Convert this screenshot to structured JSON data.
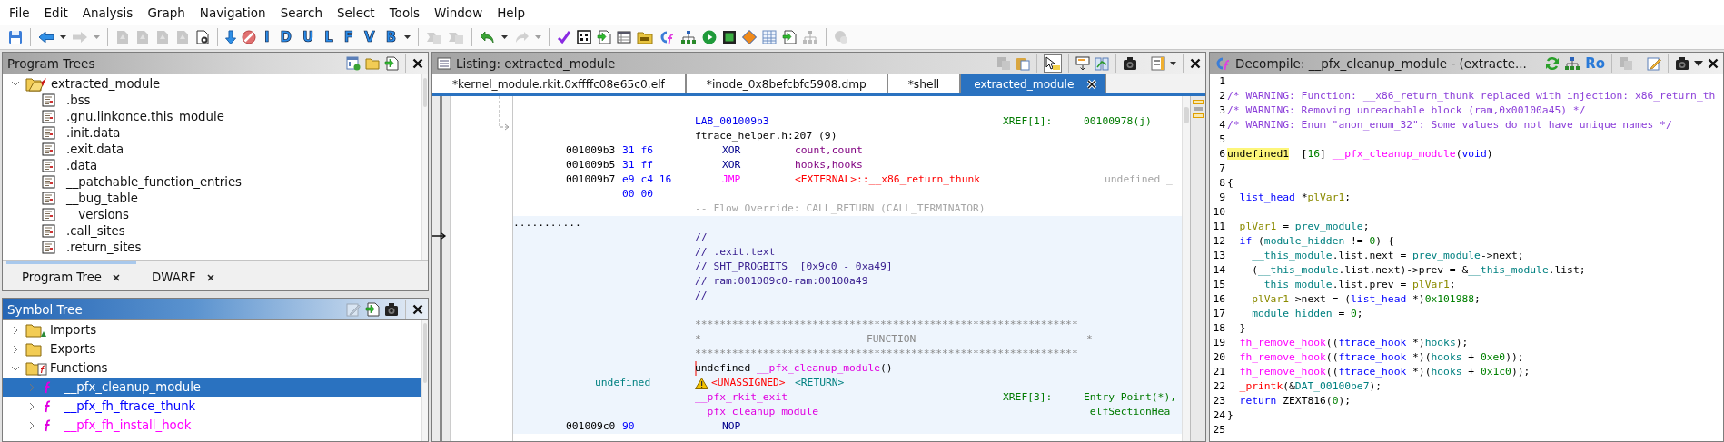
{
  "menu": [
    "File",
    "Edit",
    "Analysis",
    "Graph",
    "Navigation",
    "Search",
    "Select",
    "Tools",
    "Window",
    "Help"
  ],
  "toolbar": [
    {
      "kind": "save",
      "disabled": false
    },
    {
      "kind": "separator"
    },
    {
      "kind": "back",
      "disabled": false
    },
    {
      "kind": "dropdown",
      "disabled": false
    },
    {
      "kind": "forward",
      "disabled": true
    },
    {
      "kind": "dropdown",
      "disabled": true
    },
    {
      "kind": "separator"
    },
    {
      "kind": "doc",
      "disabled": true
    },
    {
      "kind": "doc",
      "disabled": true
    },
    {
      "kind": "doc",
      "disabled": true
    },
    {
      "kind": "doc",
      "disabled": true
    },
    {
      "kind": "docgear",
      "disabled": false
    },
    {
      "kind": "separator"
    },
    {
      "kind": "down",
      "disabled": false
    },
    {
      "kind": "nosign",
      "disabled": false
    },
    {
      "kind": "letter",
      "label": "I",
      "disabled": false
    },
    {
      "kind": "letter",
      "label": "D",
      "disabled": false
    },
    {
      "kind": "letter",
      "label": "U",
      "disabled": false
    },
    {
      "kind": "letter",
      "label": "L",
      "disabled": false
    },
    {
      "kind": "letter",
      "label": "F",
      "disabled": false
    },
    {
      "kind": "letter",
      "label": "V",
      "disabled": false
    },
    {
      "kind": "letter",
      "label": "B",
      "disabled": false
    },
    {
      "kind": "dropdown",
      "disabled": false
    },
    {
      "kind": "separator"
    },
    {
      "kind": "merge",
      "disabled": true
    },
    {
      "kind": "merge",
      "disabled": true
    },
    {
      "kind": "separator"
    },
    {
      "kind": "undo",
      "disabled": false
    },
    {
      "kind": "dropdown",
      "disabled": false
    },
    {
      "kind": "redo",
      "disabled": true
    },
    {
      "kind": "dropdown",
      "disabled": true
    },
    {
      "kind": "separator"
    },
    {
      "kind": "check",
      "disabled": false
    },
    {
      "kind": "binary",
      "disabled": false
    },
    {
      "kind": "docarrow",
      "disabled": false
    },
    {
      "kind": "table",
      "disabled": false
    },
    {
      "kind": "dtfolder",
      "disabled": false
    },
    {
      "kind": "cf",
      "disabled": false
    },
    {
      "kind": "tree",
      "disabled": false
    },
    {
      "kind": "play",
      "disabled": false
    },
    {
      "kind": "chip",
      "disabled": false
    },
    {
      "kind": "diamond",
      "disabled": false
    },
    {
      "kind": "table2",
      "disabled": false
    },
    {
      "kind": "docarrow",
      "disabled": false
    },
    {
      "kind": "tree",
      "disabled": true
    },
    {
      "kind": "separator"
    },
    {
      "kind": "bubble",
      "disabled": true
    }
  ],
  "program_trees": {
    "title": "Program Trees",
    "active": false,
    "tools": [
      {
        "kind": "newview",
        "disabled": false
      },
      {
        "kind": "folder",
        "disabled": false
      },
      {
        "kind": "docarrow",
        "disabled": false
      },
      {
        "kind": "separator"
      },
      {
        "kind": "close",
        "disabled": false
      }
    ],
    "tree": [
      {
        "label": "extracted_module",
        "expanded": true,
        "selected": false,
        "children": [
          {
            "label": ".bss",
            "selected": false
          },
          {
            "label": ".gnu.linkonce.this_module",
            "selected": false
          },
          {
            "label": ".init.data",
            "selected": false
          },
          {
            "label": ".exit.data",
            "selected": false
          },
          {
            "label": ".data",
            "selected": false
          },
          {
            "label": "__patchable_function_entries",
            "selected": false
          },
          {
            "label": "__bug_table",
            "selected": false
          },
          {
            "label": "__versions",
            "selected": false
          },
          {
            "label": ".call_sites",
            "selected": false
          },
          {
            "label": ".return_sites",
            "selected": false
          }
        ]
      }
    ],
    "tabs": [
      {
        "label": "Program Tree",
        "selected": true
      },
      {
        "label": "DWARF",
        "selected": false
      }
    ]
  },
  "symbol_tree": {
    "title": "Symbol Tree",
    "active": true,
    "tools": [
      {
        "kind": "edit",
        "disabled": true
      },
      {
        "kind": "docarrow",
        "disabled": false
      },
      {
        "kind": "camera",
        "disabled": false
      },
      {
        "kind": "separator"
      },
      {
        "kind": "close",
        "disabled": false
      }
    ],
    "tree": [
      {
        "label": "Imports",
        "kind": "imports",
        "expanded": false,
        "selected": false
      },
      {
        "label": "Exports",
        "kind": "exports",
        "expanded": false,
        "selected": false
      },
      {
        "label": "Functions",
        "kind": "functions",
        "expanded": true,
        "selected": false,
        "children": [
          {
            "label": "__pfx_cleanup_module",
            "expanded": false,
            "selected": true
          },
          {
            "label": "__pfx_fh_ftrace_thunk",
            "expanded": false,
            "selected": false,
            "color": "#0000ff"
          },
          {
            "label": "__pfx_fh_install_hook",
            "expanded": false,
            "selected": false,
            "color": "#ff00ff"
          }
        ]
      }
    ]
  },
  "listing": {
    "title": "Listing: extracted_module",
    "active": false,
    "tools": [
      {
        "kind": "copy",
        "disabled": true
      },
      {
        "kind": "paste",
        "disabled": false
      },
      {
        "kind": "separator"
      },
      {
        "kind": "cursor",
        "disabled": false,
        "pressed": true
      },
      {
        "kind": "separator"
      },
      {
        "kind": "fields",
        "disabled": false
      },
      {
        "kind": "diff",
        "disabled": false
      },
      {
        "kind": "separator"
      },
      {
        "kind": "camera",
        "disabled": false
      },
      {
        "kind": "separator"
      },
      {
        "kind": "layout",
        "disabled": false
      },
      {
        "kind": "dropdown",
        "disabled": false
      },
      {
        "kind": "separator"
      },
      {
        "kind": "close",
        "disabled": false
      }
    ],
    "tabs": [
      {
        "label": "*kernel_module.rkit.0xffffc08e65c0.elf",
        "selected": false
      },
      {
        "label": "*inode_0x8befcbfc5908.dmp",
        "selected": false
      },
      {
        "label": "*shell",
        "selected": false
      },
      {
        "label": "extracted_module",
        "selected": true
      }
    ],
    "rows": [
      {
        "highlighted": false,
        "cells": [
          {
            "kind": "label",
            "text": "LAB_001009b3"
          },
          {
            "kind": "xref",
            "text": "XREF[1]:"
          },
          {
            "kind": "xref_value",
            "text": "00100978(j)"
          }
        ]
      },
      {
        "highlighted": false,
        "cells": [
          {
            "kind": "source",
            "text": "ftrace_helper.h:207 (9)"
          }
        ]
      },
      {
        "highlighted": false,
        "cells": [
          {
            "kind": "address",
            "text": "001009b3"
          },
          {
            "kind": "bytes",
            "text": "31 f6"
          },
          {
            "kind": "mnemonic",
            "text": "XOR"
          },
          {
            "kind": "operand",
            "text": "count,count"
          }
        ]
      },
      {
        "highlighted": false,
        "cells": [
          {
            "kind": "address",
            "text": "001009b5"
          },
          {
            "kind": "bytes",
            "text": "31 ff"
          },
          {
            "kind": "mnemonic",
            "text": "XOR"
          },
          {
            "kind": "operand",
            "text": "hooks,hooks"
          }
        ]
      },
      {
        "highlighted": false,
        "cells": [
          {
            "kind": "address",
            "text": "001009b7"
          },
          {
            "kind": "bytes",
            "text": "e9 c4 16"
          },
          {
            "kind": "jump",
            "text": "JMP"
          },
          {
            "kind": "external",
            "text": "<EXTERNAL>::__x86_return_thunk"
          },
          {
            "kind": "trailing",
            "text": "undefined _"
          }
        ]
      },
      {
        "highlighted": false,
        "cells": [
          {
            "kind": "bytes",
            "text": "00 00"
          }
        ]
      },
      {
        "highlighted": false,
        "cells": [
          {
            "kind": "flow",
            "text": "-- Flow Override: CALL_RETURN (CALL_TERMINATOR)"
          }
        ]
      },
      {
        "highlighted": true,
        "cells": [
          {
            "kind": "dots",
            "text": "..........."
          }
        ]
      },
      {
        "highlighted": true,
        "cells": [
          {
            "kind": "comment",
            "text": "//"
          }
        ]
      },
      {
        "highlighted": true,
        "cells": [
          {
            "kind": "comment",
            "text": "// .exit.text"
          }
        ]
      },
      {
        "highlighted": true,
        "cells": [
          {
            "kind": "comment",
            "text": "// SHT_PROGBITS  [0x9c0 - 0xa49]"
          }
        ]
      },
      {
        "highlighted": true,
        "cells": [
          {
            "kind": "comment",
            "text": "// ram:001009c0-ram:00100a49"
          }
        ]
      },
      {
        "highlighted": true,
        "cells": [
          {
            "kind": "comment",
            "text": "//"
          }
        ]
      },
      {
        "highlighted": true
      },
      {
        "highlighted": true,
        "cells": [
          {
            "kind": "stars",
            "text": "**************************************************************"
          }
        ]
      },
      {
        "highlighted": true,
        "cells": [
          {
            "kind": "stars",
            "text": "*"
          },
          {
            "kind": "banner_title",
            "text": "FUNCTION"
          },
          {
            "kind": "banner_end",
            "text": "*"
          }
        ]
      },
      {
        "highlighted": true,
        "cells": [
          {
            "kind": "stars",
            "text": "**************************************************************"
          }
        ]
      },
      {
        "highlighted": true,
        "cells": [
          {
            "kind": "plain",
            "cursor": true,
            "segments": [
              {
                "text": "undefined ",
                "kind": "plain"
              },
              {
                "text": "__pfx_cleanup_module",
                "kind": "name"
              },
              {
                "text": "()",
                "kind": "plain"
              }
            ]
          }
        ]
      },
      {
        "highlighted": true,
        "cells": [
          {
            "kind": "type",
            "text": "undefined"
          },
          {
            "kind": "error",
            "text": "<UNASSIGNED>",
            "warning": true
          },
          {
            "kind": "return",
            "text": "<RETURN>"
          }
        ]
      },
      {
        "highlighted": true,
        "cells": [
          {
            "kind": "name",
            "text": "__pfx_rkit_exit"
          },
          {
            "kind": "xref",
            "text": "XREF[3]:"
          },
          {
            "kind": "xref_value",
            "text": "Entry Point(*),"
          }
        ]
      },
      {
        "highlighted": true,
        "cells": [
          {
            "kind": "name",
            "text": "__pfx_cleanup_module"
          },
          {
            "kind": "xref_value",
            "text": "_elfSectionHea"
          }
        ]
      },
      {
        "highlighted": true,
        "cells": [
          {
            "kind": "address",
            "text": "001009c0"
          },
          {
            "kind": "bytes",
            "text": "90"
          },
          {
            "kind": "mnemonic",
            "text": "NOP"
          }
        ]
      }
    ]
  },
  "decompile": {
    "title": "Decompile: __pfx_cleanup_module - (extracte...",
    "active": false,
    "tools": [
      {
        "kind": "refresh",
        "disabled": false
      },
      {
        "kind": "tree",
        "disabled": false
      },
      {
        "kind": "text",
        "label": "Ro",
        "disabled": false
      },
      {
        "kind": "separator"
      },
      {
        "kind": "copy",
        "disabled": true
      },
      {
        "kind": "separator"
      },
      {
        "kind": "edit",
        "disabled": false
      },
      {
        "kind": "separator"
      },
      {
        "kind": "camera",
        "disabled": false
      },
      {
        "kind": "menucaret",
        "disabled": false
      },
      {
        "kind": "close",
        "disabled": false
      }
    ],
    "lines": [
      {
        "number": "1"
      },
      {
        "number": "2",
        "segments": [
          {
            "text": "/* WARNING: Function: __x86_return_thunk replaced with injection: x86_return_th",
            "kind": "comment"
          }
        ]
      },
      {
        "number": "3",
        "segments": [
          {
            "text": "/* WARNING: Removing unreachable block (ram,0x00100a45) */",
            "kind": "comment"
          }
        ]
      },
      {
        "number": "4",
        "segments": [
          {
            "text": "/* WARNING: Enum \"anon_enum_32\": Some values do not have unique names */",
            "kind": "comment"
          }
        ]
      },
      {
        "number": "5"
      },
      {
        "number": "6",
        "segments": [
          {
            "text": "undefined1",
            "kind": "highlight"
          },
          {
            "text": "  [",
            "kind": "plain"
          },
          {
            "text": "16",
            "kind": "number"
          },
          {
            "text": "] ",
            "kind": "plain"
          },
          {
            "text": "__pfx_cleanup_module",
            "kind": "function"
          },
          {
            "text": "(",
            "kind": "plain"
          },
          {
            "text": "void",
            "kind": "keyword"
          },
          {
            "text": ")",
            "kind": "plain"
          }
        ]
      },
      {
        "number": "7"
      },
      {
        "number": "8",
        "segments": [
          {
            "text": "{",
            "kind": "plain"
          }
        ]
      },
      {
        "number": "9",
        "segments": [
          {
            "text": "  list_head",
            "kind": "keyword"
          },
          {
            "text": " *",
            "kind": "plain"
          },
          {
            "text": "plVar1",
            "kind": "local"
          },
          {
            "text": ";",
            "kind": "plain"
          }
        ]
      },
      {
        "number": "10"
      },
      {
        "number": "11",
        "segments": [
          {
            "text": "  plVar1",
            "kind": "local"
          },
          {
            "text": " = ",
            "kind": "plain"
          },
          {
            "text": "prev_module",
            "kind": "global"
          },
          {
            "text": ";",
            "kind": "plain"
          }
        ]
      },
      {
        "number": "12",
        "segments": [
          {
            "text": "  if",
            "kind": "keyword"
          },
          {
            "text": " (",
            "kind": "plain"
          },
          {
            "text": "module_hidden",
            "kind": "global"
          },
          {
            "text": " != ",
            "kind": "plain"
          },
          {
            "text": "0",
            "kind": "number"
          },
          {
            "text": ") {",
            "kind": "plain"
          }
        ]
      },
      {
        "number": "13",
        "segments": [
          {
            "text": "    __this_module",
            "kind": "global"
          },
          {
            "text": ".list.next = ",
            "kind": "plain"
          },
          {
            "text": "prev_module",
            "kind": "global"
          },
          {
            "text": "->next;",
            "kind": "plain"
          }
        ]
      },
      {
        "number": "14",
        "segments": [
          {
            "text": "    (",
            "kind": "plain"
          },
          {
            "text": "__this_module",
            "kind": "global"
          },
          {
            "text": ".list.next)->prev = &",
            "kind": "plain"
          },
          {
            "text": "__this_module",
            "kind": "global"
          },
          {
            "text": ".list;",
            "kind": "plain"
          }
        ]
      },
      {
        "number": "15",
        "segments": [
          {
            "text": "    __this_module",
            "kind": "global"
          },
          {
            "text": ".list.prev = ",
            "kind": "plain"
          },
          {
            "text": "plVar1",
            "kind": "local"
          },
          {
            "text": ";",
            "kind": "plain"
          }
        ]
      },
      {
        "number": "16",
        "segments": [
          {
            "text": "    plVar1",
            "kind": "local"
          },
          {
            "text": "->next = (",
            "kind": "plain"
          },
          {
            "text": "list_head",
            "kind": "keyword"
          },
          {
            "text": " *)",
            "kind": "plain"
          },
          {
            "text": "0x101988",
            "kind": "number"
          },
          {
            "text": ";",
            "kind": "plain"
          }
        ]
      },
      {
        "number": "17",
        "segments": [
          {
            "text": "    module_hidden",
            "kind": "global"
          },
          {
            "text": " = ",
            "kind": "plain"
          },
          {
            "text": "0",
            "kind": "number"
          },
          {
            "text": ";",
            "kind": "plain"
          }
        ]
      },
      {
        "number": "18",
        "segments": [
          {
            "text": "  }",
            "kind": "plain"
          }
        ]
      },
      {
        "number": "19",
        "segments": [
          {
            "text": "  fh_remove_hook",
            "kind": "function"
          },
          {
            "text": "((",
            "kind": "plain"
          },
          {
            "text": "ftrace_hook",
            "kind": "keyword"
          },
          {
            "text": " *)",
            "kind": "plain"
          },
          {
            "text": "hooks",
            "kind": "global"
          },
          {
            "text": ");",
            "kind": "plain"
          }
        ]
      },
      {
        "number": "20",
        "segments": [
          {
            "text": "  fh_remove_hook",
            "kind": "function"
          },
          {
            "text": "((",
            "kind": "plain"
          },
          {
            "text": "ftrace_hook",
            "kind": "keyword"
          },
          {
            "text": " *)(",
            "kind": "plain"
          },
          {
            "text": "hooks",
            "kind": "global"
          },
          {
            "text": " + ",
            "kind": "plain"
          },
          {
            "text": "0xe0",
            "kind": "number"
          },
          {
            "text": "));",
            "kind": "plain"
          }
        ]
      },
      {
        "number": "21",
        "segments": [
          {
            "text": "  fh_remove_hook",
            "kind": "function"
          },
          {
            "text": "((",
            "kind": "plain"
          },
          {
            "text": "ftrace_hook",
            "kind": "keyword"
          },
          {
            "text": " *)(",
            "kind": "plain"
          },
          {
            "text": "hooks",
            "kind": "global"
          },
          {
            "text": " + ",
            "kind": "plain"
          },
          {
            "text": "0x1c0",
            "kind": "number"
          },
          {
            "text": "));",
            "kind": "plain"
          }
        ]
      },
      {
        "number": "22",
        "segments": [
          {
            "text": "  _printk",
            "kind": "error"
          },
          {
            "text": "(&",
            "kind": "plain"
          },
          {
            "text": "DAT_00100be7",
            "kind": "global"
          },
          {
            "text": ");",
            "kind": "plain"
          }
        ]
      },
      {
        "number": "23",
        "segments": [
          {
            "text": "  return",
            "kind": "keyword"
          },
          {
            "text": " ZEXT816(",
            "kind": "plain"
          },
          {
            "text": "0",
            "kind": "number"
          },
          {
            "text": ");",
            "kind": "plain"
          }
        ]
      },
      {
        "number": "24",
        "segments": [
          {
            "text": "}",
            "kind": "plain"
          }
        ]
      },
      {
        "number": "25"
      }
    ]
  }
}
